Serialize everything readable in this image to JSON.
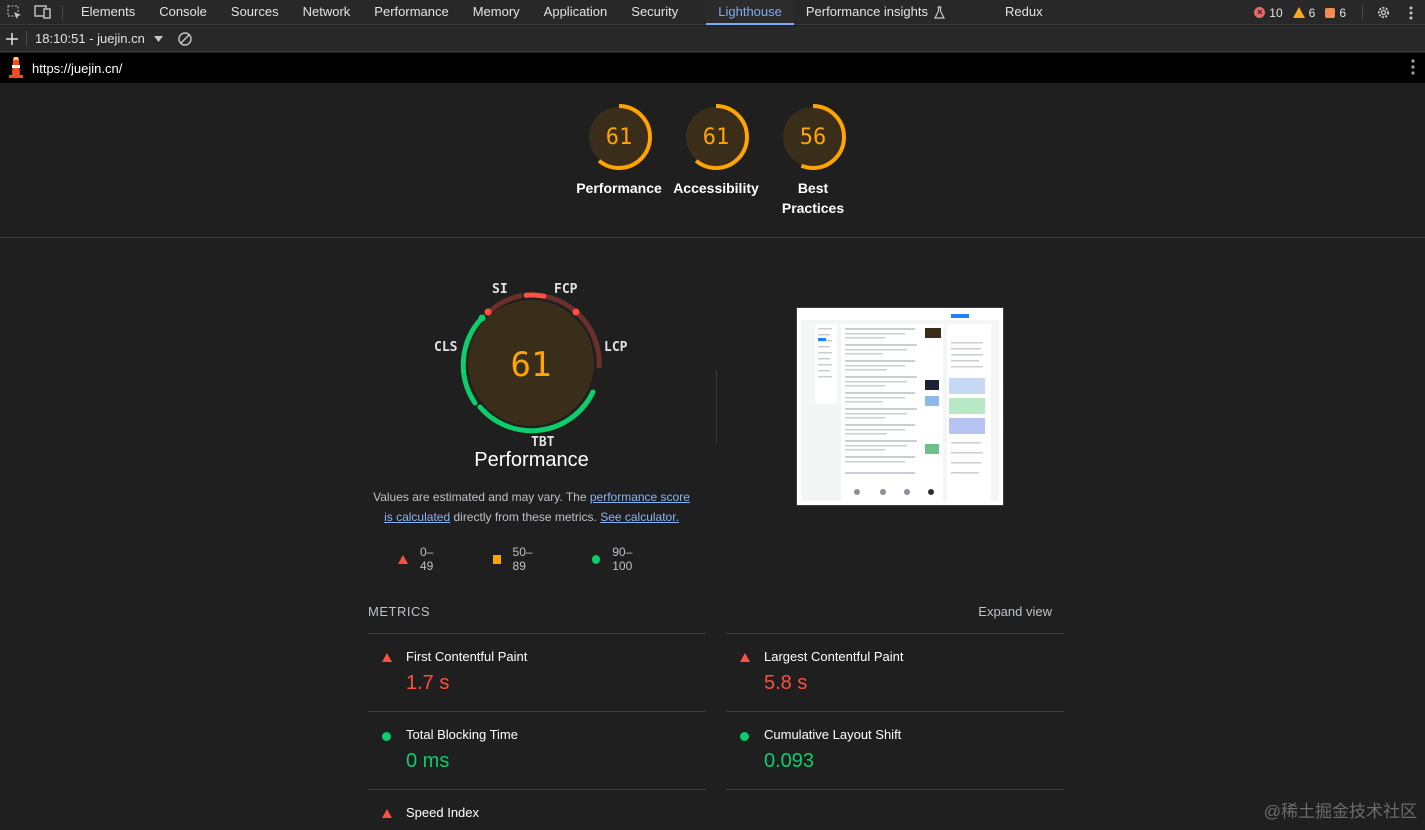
{
  "tabbar": {
    "tabs": [
      "Elements",
      "Console",
      "Sources",
      "Network",
      "Performance",
      "Memory",
      "Application",
      "Security",
      "Lighthouse",
      "Performance insights",
      "Redux"
    ],
    "active": "Lighthouse",
    "error_count": "10",
    "warning_count": "6",
    "issue_count": "6"
  },
  "reportbar": {
    "report_label": "18:10:51 - juejin.cn"
  },
  "urlbar": {
    "url": "https://juejin.cn/"
  },
  "categories": [
    {
      "score": "61",
      "label": "Performance",
      "value": 61
    },
    {
      "score": "61",
      "label": "Accessibility",
      "value": 61
    },
    {
      "score": "56",
      "label": "Best Practices",
      "value": 56
    }
  ],
  "performance": {
    "score": "61",
    "title": "Performance",
    "gauge_labels": {
      "si": "SI",
      "fcp": "FCP",
      "lcp": "LCP",
      "cls": "CLS",
      "tbt": "TBT"
    },
    "desc_prefix": "Values are estimated and may vary. The ",
    "desc_link1": "performance score is calculated",
    "desc_mid": " directly from these metrics. ",
    "desc_link2": "See calculator.",
    "legend": [
      {
        "range": "0–49",
        "marker": "triangle-red"
      },
      {
        "range": "50–89",
        "marker": "square-orange"
      },
      {
        "range": "90–100",
        "marker": "circle-green"
      }
    ]
  },
  "metrics": {
    "title": "METRICS",
    "expand_label": "Expand view",
    "items": [
      {
        "name": "First Contentful Paint",
        "value": "1.7 s",
        "status": "fail"
      },
      {
        "name": "Largest Contentful Paint",
        "value": "5.8 s",
        "status": "fail"
      },
      {
        "name": "Total Blocking Time",
        "value": "0 ms",
        "status": "pass"
      },
      {
        "name": "Cumulative Layout Shift",
        "value": "0.093",
        "status": "pass"
      },
      {
        "name": "Speed Index",
        "value": "",
        "status": "fail"
      }
    ]
  },
  "watermark": "@稀土掘金技术社区",
  "colors": {
    "average": "#ffa400",
    "fail": "#ff4e42",
    "pass": "#0cce6b",
    "accent": "#7cacf8"
  }
}
